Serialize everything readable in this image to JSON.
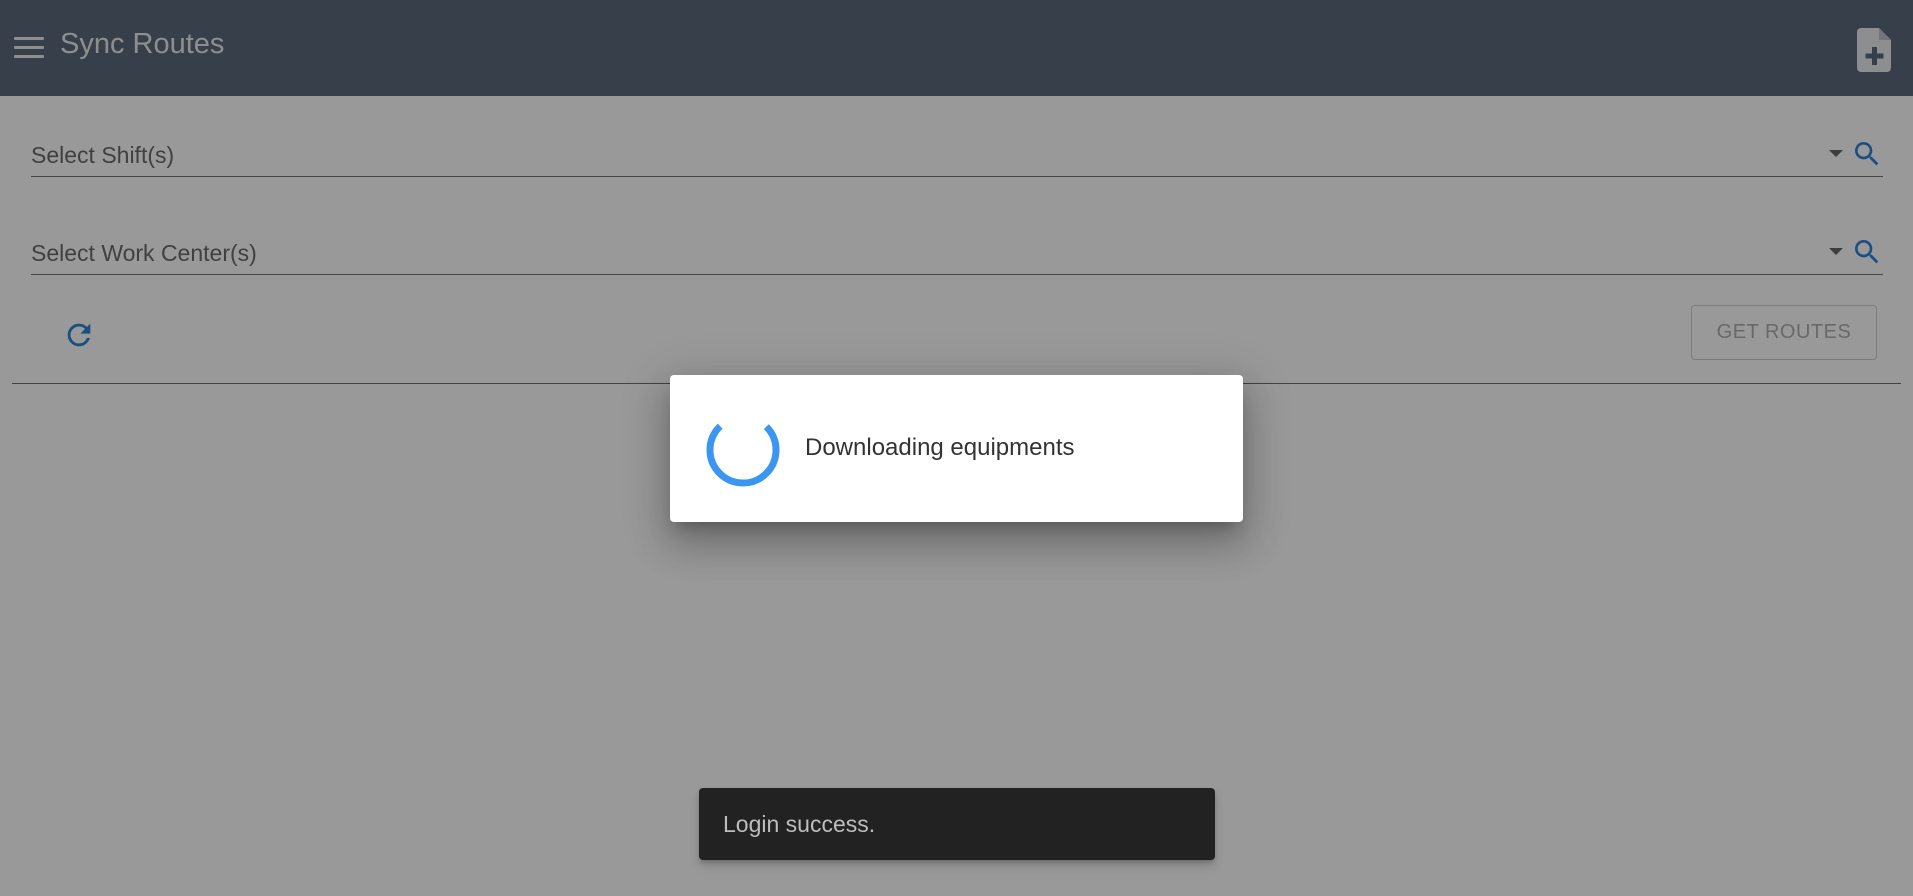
{
  "header": {
    "title": "Sync Routes",
    "menu_icon": "menu-icon",
    "action_icon": "new-document-icon"
  },
  "filters": {
    "shift": {
      "label": "Select Shift(s)"
    },
    "work_center": {
      "label": "Select Work Center(s)"
    }
  },
  "actions": {
    "get_routes_label": "GET ROUTES",
    "refresh_icon": "refresh-icon"
  },
  "dialog": {
    "message": "Downloading equipments",
    "icon": "spinner-icon"
  },
  "snackbar": {
    "message": "Login success."
  },
  "colors": {
    "header": "#4a5a6e",
    "accent": "#1976d2",
    "spinner": "#3a96f2"
  }
}
